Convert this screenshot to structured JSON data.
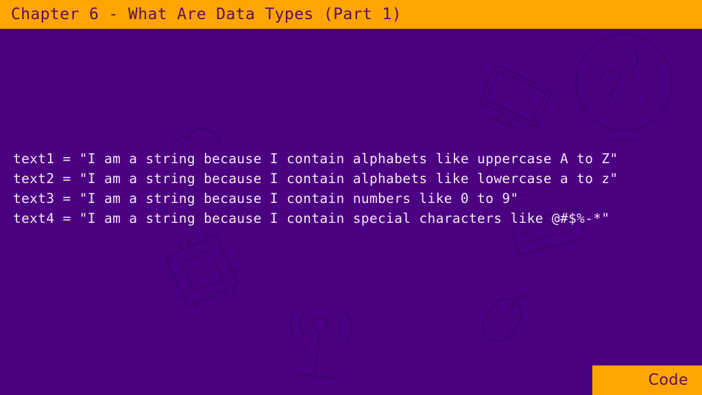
{
  "header": {
    "title": "Chapter 6 - What Are Data Types (Part 1)"
  },
  "code": {
    "lines": [
      "text1 = \"I am a string because I contain alphabets like uppercase A to Z\"",
      "text2 = \"I am a string because I contain alphabets like lowercase a to z\"",
      "text3 = \"I am a string because I contain numbers like 0 to 9\"",
      "text4 = \"I am a string because I contain special characters like @#$%-*\""
    ]
  },
  "footer": {
    "label": "Code"
  },
  "colors": {
    "background": "#4B0082",
    "accent": "#FFA500",
    "accent_text": "#5B0F5E",
    "code_text": "#F5E8F4"
  },
  "watermark_icons": [
    "globe-icon",
    "monitor-icon",
    "cpu-chip-icon",
    "antenna-icon",
    "mouse-icon",
    "keyboard-icon",
    "cloud-icon"
  ]
}
